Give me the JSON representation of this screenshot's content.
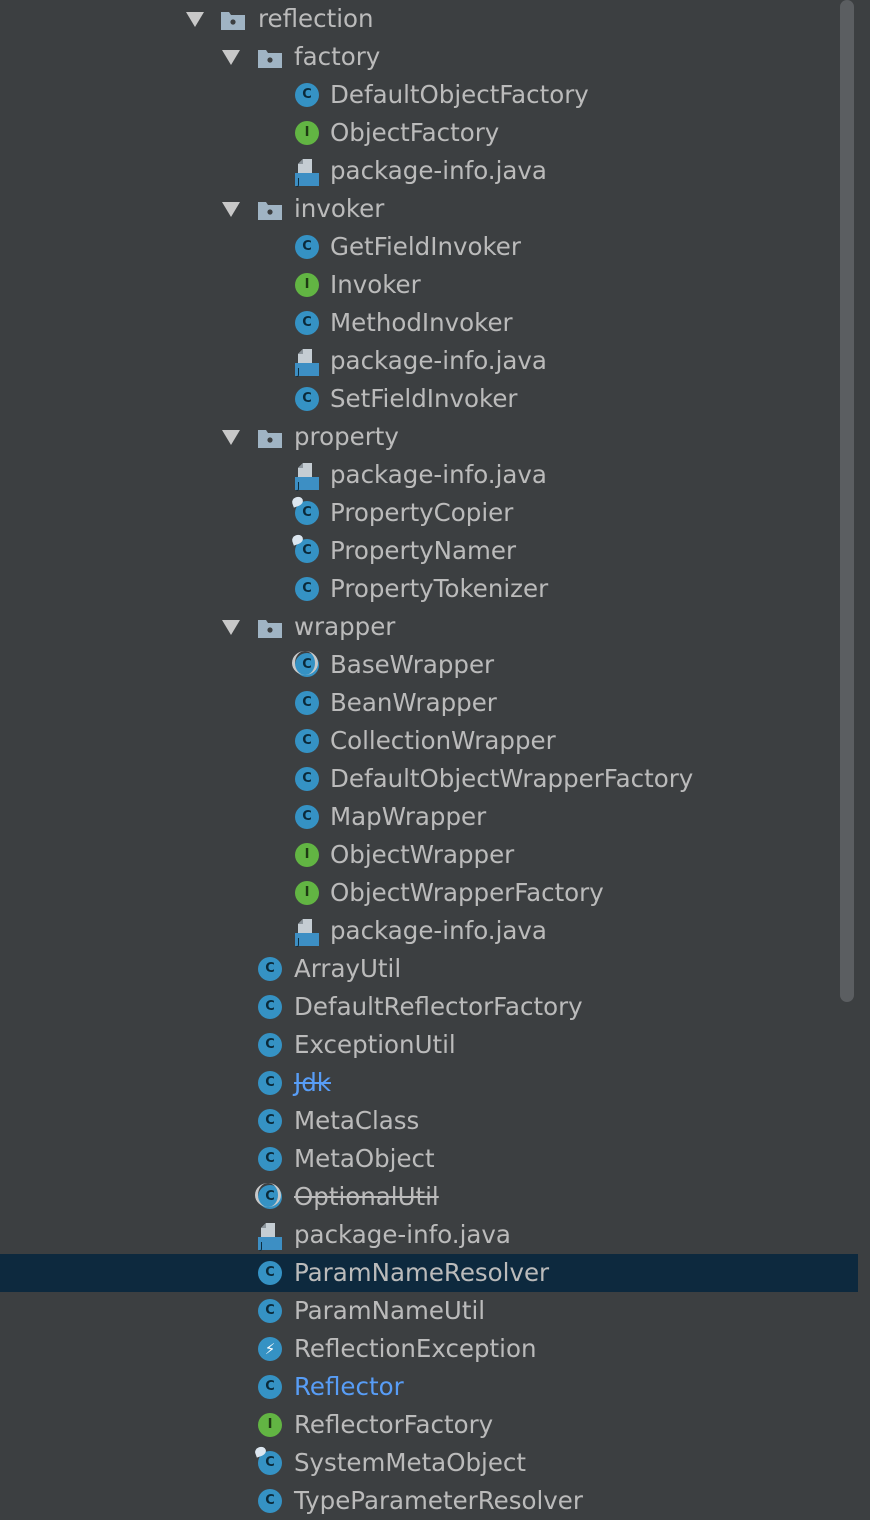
{
  "colors": {
    "background": "#3c3f41",
    "selection": "#0d293e",
    "class_icon": "#3592c4",
    "interface_icon": "#62b543",
    "folder_icon": "#a0b4c4",
    "text": "#bbbbbb",
    "highlight_text": "#589df6"
  },
  "tree": [
    {
      "label": "reflection",
      "icon": "package-folder-icon",
      "level": 0,
      "expanded": true
    },
    {
      "label": "factory",
      "icon": "package-folder-icon",
      "level": 1,
      "expanded": true
    },
    {
      "label": "DefaultObjectFactory",
      "icon": "class-icon",
      "level": 2
    },
    {
      "label": "ObjectFactory",
      "icon": "interface-icon",
      "level": 2
    },
    {
      "label": "package-info.java",
      "icon": "java-file-icon",
      "level": 2
    },
    {
      "label": "invoker",
      "icon": "package-folder-icon",
      "level": 1,
      "expanded": true
    },
    {
      "label": "GetFieldInvoker",
      "icon": "class-icon",
      "level": 2
    },
    {
      "label": "Invoker",
      "icon": "interface-icon",
      "level": 2
    },
    {
      "label": "MethodInvoker",
      "icon": "class-icon",
      "level": 2
    },
    {
      "label": "package-info.java",
      "icon": "java-file-icon",
      "level": 2
    },
    {
      "label": "SetFieldInvoker",
      "icon": "class-icon",
      "level": 2
    },
    {
      "label": "property",
      "icon": "package-folder-icon",
      "level": 1,
      "expanded": true
    },
    {
      "label": "package-info.java",
      "icon": "java-file-icon",
      "level": 2
    },
    {
      "label": "PropertyCopier",
      "icon": "static-class-icon",
      "level": 2
    },
    {
      "label": "PropertyNamer",
      "icon": "static-class-icon",
      "level": 2
    },
    {
      "label": "PropertyTokenizer",
      "icon": "class-icon",
      "level": 2
    },
    {
      "label": "wrapper",
      "icon": "package-folder-icon",
      "level": 1,
      "expanded": true
    },
    {
      "label": "BaseWrapper",
      "icon": "abstract-class-icon",
      "level": 2
    },
    {
      "label": "BeanWrapper",
      "icon": "class-icon",
      "level": 2
    },
    {
      "label": "CollectionWrapper",
      "icon": "class-icon",
      "level": 2
    },
    {
      "label": "DefaultObjectWrapperFactory",
      "icon": "class-icon",
      "level": 2
    },
    {
      "label": "MapWrapper",
      "icon": "class-icon",
      "level": 2
    },
    {
      "label": "ObjectWrapper",
      "icon": "interface-icon",
      "level": 2
    },
    {
      "label": "ObjectWrapperFactory",
      "icon": "interface-icon",
      "level": 2
    },
    {
      "label": "package-info.java",
      "icon": "java-file-icon",
      "level": 2
    },
    {
      "label": "ArrayUtil",
      "icon": "class-icon",
      "level": 1
    },
    {
      "label": "DefaultReflectorFactory",
      "icon": "class-icon",
      "level": 1
    },
    {
      "label": "ExceptionUtil",
      "icon": "class-icon",
      "level": 1
    },
    {
      "label": "Jdk",
      "icon": "class-icon",
      "level": 1,
      "style": "deprecated-blue"
    },
    {
      "label": "MetaClass",
      "icon": "class-icon",
      "level": 1
    },
    {
      "label": "MetaObject",
      "icon": "class-icon",
      "level": 1
    },
    {
      "label": "OptionalUtil",
      "icon": "abstract-class-icon",
      "level": 1,
      "style": "deprecated"
    },
    {
      "label": "package-info.java",
      "icon": "java-file-icon",
      "level": 1
    },
    {
      "label": "ParamNameResolver",
      "icon": "class-icon",
      "level": 1,
      "selected": true
    },
    {
      "label": "ParamNameUtil",
      "icon": "class-icon",
      "level": 1
    },
    {
      "label": "ReflectionException",
      "icon": "exception-class-icon",
      "level": 1
    },
    {
      "label": "Reflector",
      "icon": "class-icon",
      "level": 1,
      "style": "blue"
    },
    {
      "label": "ReflectorFactory",
      "icon": "interface-icon",
      "level": 1
    },
    {
      "label": "SystemMetaObject",
      "icon": "static-class-icon",
      "level": 1
    },
    {
      "label": "TypeParameterResolver",
      "icon": "class-icon",
      "level": 1
    }
  ]
}
